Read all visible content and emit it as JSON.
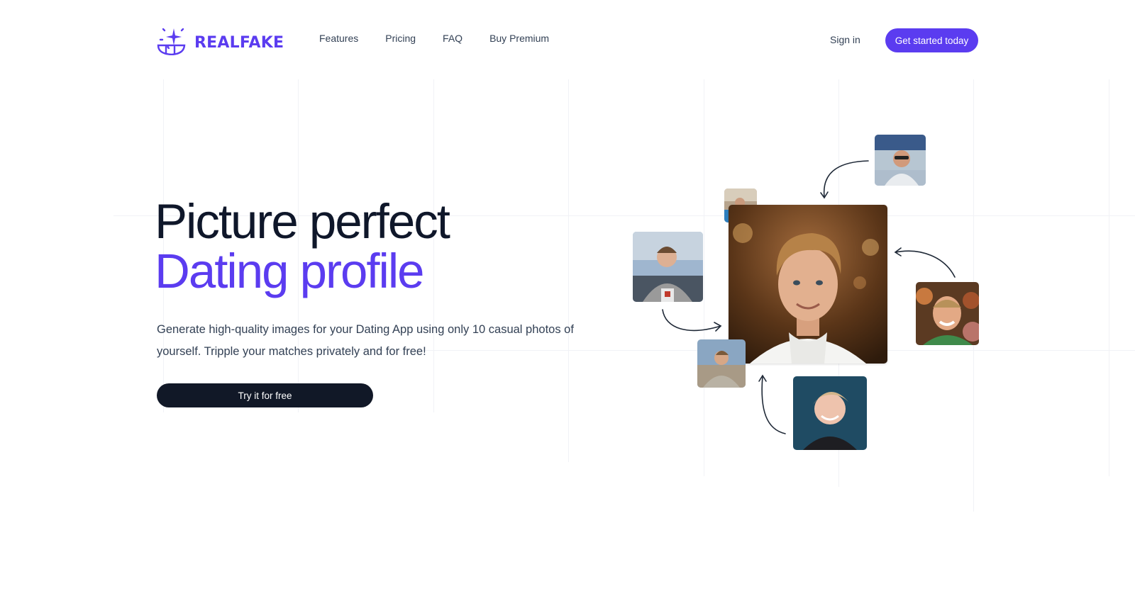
{
  "brand": {
    "name": "REALFAKE",
    "logo_icon": "sparkle-smile-logo",
    "accent_color": "#5b3cf0"
  },
  "nav": {
    "items": [
      {
        "label": "Features"
      },
      {
        "label": "Pricing"
      },
      {
        "label": "FAQ"
      },
      {
        "label": "Buy Premium"
      }
    ],
    "signin_label": "Sign in",
    "cta_label": "Get started today"
  },
  "hero": {
    "title_line1": "Picture perfect",
    "title_line2": "Dating profile",
    "description": "Generate high-quality images for your Dating App using only 10 casual photos of yourself. Tripple your matches privately and for free!",
    "cta_label": "Try it for free"
  },
  "gallery": {
    "photos": [
      {
        "name": "main-portrait"
      },
      {
        "name": "photo-top-right"
      },
      {
        "name": "photo-left"
      },
      {
        "name": "photo-right"
      },
      {
        "name": "photo-bottom"
      },
      {
        "name": "photo-small-top"
      },
      {
        "name": "photo-small-bottom"
      }
    ]
  }
}
